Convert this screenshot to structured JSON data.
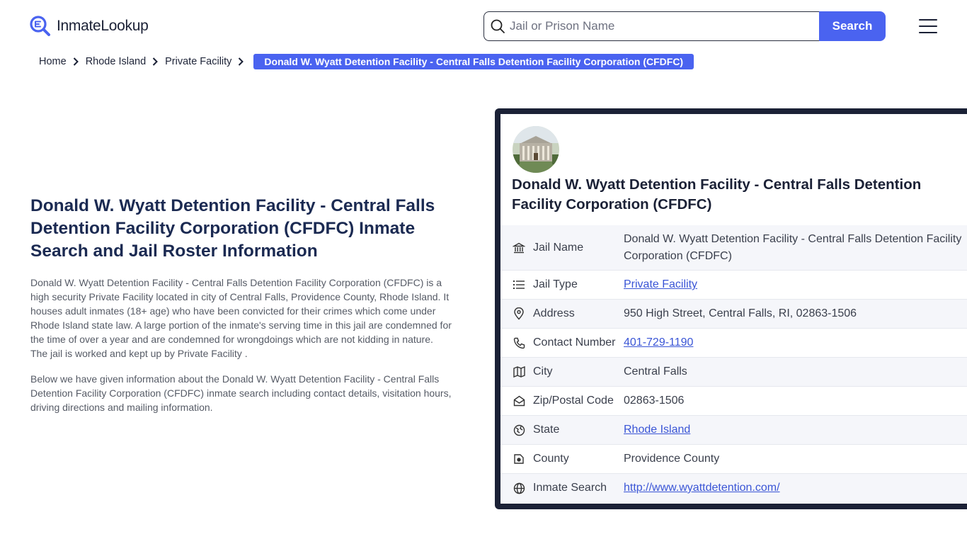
{
  "brand": {
    "name": "InmateLookup",
    "accent": "#4a63f0",
    "dark": "#1b2136"
  },
  "search": {
    "placeholder": "Jail or Prison Name",
    "button_label": "Search"
  },
  "breadcrumb": {
    "items": [
      "Home",
      "Rhode Island",
      "Private Facility"
    ],
    "current": "Donald W. Wyatt Detention Facility - Central Falls Detention Facility Corporation (CFDFC)"
  },
  "main": {
    "title": "Donald W. Wyatt Detention Facility - Central Falls Detention Facility Corporation (CFDFC) Inmate Search and Jail Roster Information",
    "paragraphs": [
      "Donald W. Wyatt Detention Facility - Central Falls Detention Facility Corporation (CFDFC) is a high security Private Facility located in city of Central Falls, Providence County, Rhode Island. It houses adult inmates (18+ age) who have been convicted for their crimes which come under Rhode Island state law. A large portion of the inmate's serving time in this jail are condemned for the time of over a year and are condemned for wrongdoings which are not kidding in nature. The jail is worked and kept up by Private Facility .",
      "Below we have given information about the Donald W. Wyatt Detention Facility - Central Falls Detention Facility Corporation (CFDFC) inmate search including contact details, visitation hours, driving directions and mailing information."
    ]
  },
  "card": {
    "title": "Donald W. Wyatt Detention Facility - Central Falls Detention Facility Corporation (CFDFC)",
    "rows": [
      {
        "icon": "bank-icon",
        "label": "Jail Name",
        "value": "Donald W. Wyatt Detention Facility - Central Falls Detention Facility Corporation (CFDFC)",
        "link": false
      },
      {
        "icon": "list-icon",
        "label": "Jail Type",
        "value": "Private Facility",
        "link": true
      },
      {
        "icon": "map-pin-icon",
        "label": "Address",
        "value": "950 High Street, Central Falls, RI, 02863-1506",
        "link": false
      },
      {
        "icon": "phone-icon",
        "label": "Contact Number",
        "value": "401-729-1190",
        "link": true
      },
      {
        "icon": "map-icon",
        "label": "City",
        "value": "Central Falls",
        "link": false
      },
      {
        "icon": "mail-open-icon",
        "label": "Zip/Postal Code",
        "value": "02863-1506",
        "link": false
      },
      {
        "icon": "globe-compass-icon",
        "label": "State",
        "value": "Rhode Island",
        "link": true
      },
      {
        "icon": "county-map-icon",
        "label": "County",
        "value": "Providence County",
        "link": false
      },
      {
        "icon": "world-icon",
        "label": "Inmate Search",
        "value": "http://www.wyattdetention.com/",
        "link": true
      }
    ]
  }
}
